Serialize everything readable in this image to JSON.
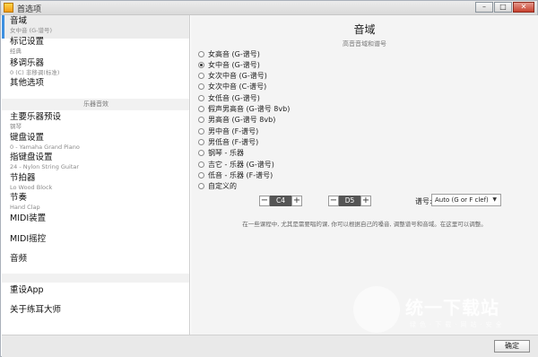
{
  "window": {
    "title": "首选项",
    "buttons": [
      "–",
      "□",
      "✕"
    ]
  },
  "sidebar": {
    "items": [
      {
        "title": "音域",
        "subtitle": "女中音 (G-谱号)"
      },
      {
        "title": "标记设置",
        "subtitle": "经典"
      },
      {
        "title": "移调乐器",
        "subtitle": "0 (C) 非移调(标准)"
      },
      {
        "title": "其他选项",
        "subtitle": ""
      }
    ],
    "section_header": "乐器音效",
    "items2": [
      {
        "title": "主要乐器预设",
        "subtitle": "钢琴"
      },
      {
        "title": "键盘设置",
        "subtitle": "0 - Yamaha Grand Piano"
      },
      {
        "title": "指键盘设置",
        "subtitle": "24 - Nylon String Guitar"
      },
      {
        "title": "节拍器",
        "subtitle": "Lo Wood Block"
      },
      {
        "title": "节奏",
        "subtitle": "Hand Clap"
      },
      {
        "title": "MIDI装置",
        "subtitle": ""
      },
      {
        "title": "MIDI摇控",
        "subtitle": ""
      },
      {
        "title": "音频",
        "subtitle": ""
      }
    ],
    "items3": [
      {
        "title": "重设App"
      },
      {
        "title": "关于练耳大师"
      }
    ]
  },
  "main": {
    "title": "音域",
    "subtitle": "高音音域和谱号",
    "options": [
      "女高音 (G-谱号)",
      "女中音 (G-谱号)",
      "女次中音 (G-谱号)",
      "女次中音 (C-谱号)",
      "女低音 (G-谱号)",
      "假声男高音 (G-谱号 8vb)",
      "男高音 (G-谱号 8vb)",
      "男中音 (F-谱号)",
      "男低音 (F-谱号)",
      "钢琴 - 乐器",
      "吉它 - 乐器 (G-谱号)",
      "低音 - 乐器 (F-谱号)",
      "自定义的"
    ],
    "selected_index": 1,
    "low_note": "C4",
    "high_note": "D5",
    "clef_label": "谱号:",
    "clef_value": "Auto (G or F clef)",
    "info": "在一些课程中, 尤其是需要唱的课, 你可以根据自己的嗓音, 调整谱号和音域。在这里可以调整。"
  },
  "watermark": {
    "text": "统一下载站",
    "sub": "绿色·下载·网站·安全"
  },
  "footer": {
    "ok_label": "确定"
  },
  "colors": {
    "accent": "#3d8fe0",
    "stepper_value_bg": "#555555"
  }
}
